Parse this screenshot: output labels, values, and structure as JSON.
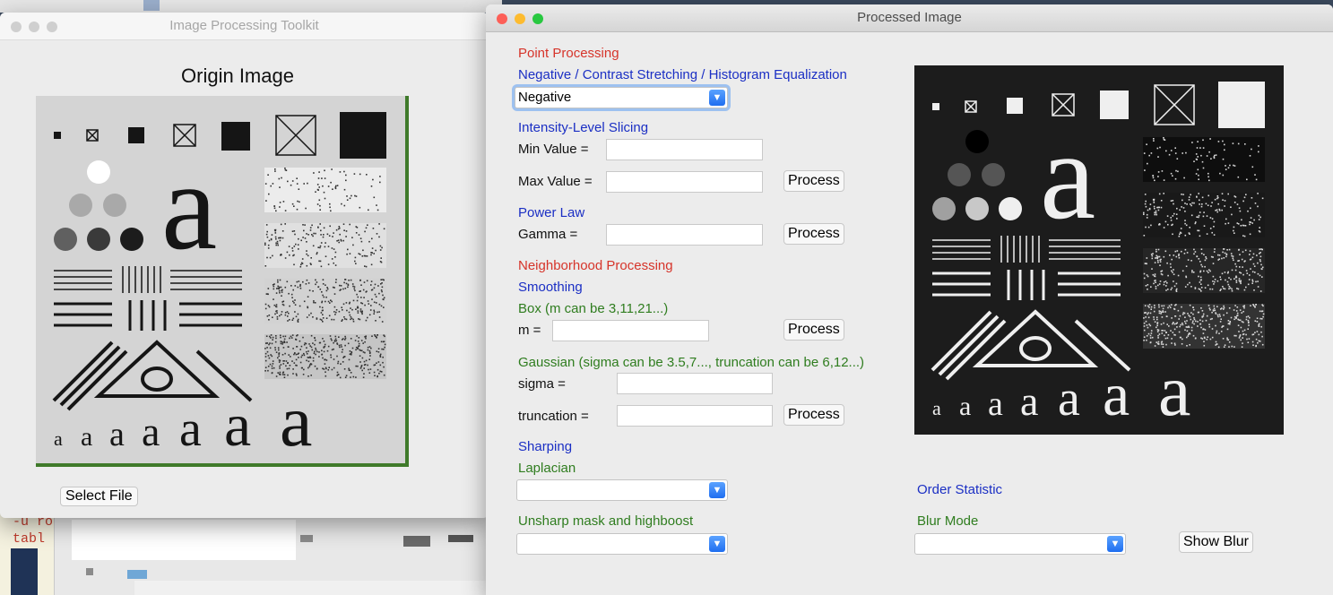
{
  "background": {
    "terminal_lines": [
      "-u ro",
      "tabl"
    ]
  },
  "origin_window": {
    "title": "Image Processing Toolkit",
    "heading": "Origin Image",
    "select_button": "Select File",
    "image": {
      "tiny_letters": [
        "a",
        "a",
        "a",
        "a",
        "a",
        "a",
        "a"
      ]
    }
  },
  "processed_window": {
    "title": "Processed Image",
    "point_processing": "Point Processing",
    "neg_label": "Negative / Contrast Stretching / Histogram Equalization",
    "neg_select_value": "Negative",
    "slicing_label": "Intensity-Level Slicing",
    "min_label": "Min Value =",
    "max_label": "Max Value =",
    "process": "Process",
    "power_label": "Power Law",
    "gamma_label": "Gamma =",
    "neighborhood": "Neighborhood Processing",
    "smoothing": "Smoothing",
    "box_label": "Box (m can be 3,11,21...)",
    "m_label": "m =",
    "gaussian_label": "Gaussian (sigma can be 3.5,7..., truncation can be 6,12...)",
    "sigma_label": "sigma =",
    "truncation_label": "truncation =",
    "sharping": "Sharping",
    "laplacian": "Laplacian",
    "unsharp": "Unsharp mask and highboost",
    "order_statistic": "Order Statistic",
    "blur_mode": "Blur Mode",
    "show_blur": "Show Blur"
  },
  "colors": {
    "section_red": "#d6342a",
    "label_blue": "#1b2fc4",
    "label_green": "#2f7d1f",
    "frame_green": "#3f7a2a"
  }
}
